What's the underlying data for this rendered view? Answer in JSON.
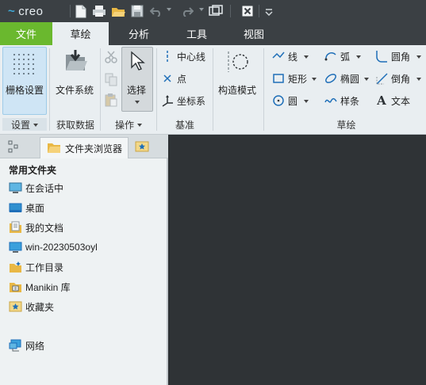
{
  "app": {
    "logo_text": "creo",
    "logo_mark": "~"
  },
  "quick_access": [
    "new-icon",
    "print-icon",
    "open-icon",
    "save-icon",
    "undo-icon",
    "redo-icon",
    "regenerate-icon",
    "close-window-icon",
    "customize-icon"
  ],
  "tabs": [
    {
      "label": "文件"
    },
    {
      "label": "草绘"
    },
    {
      "label": "分析"
    },
    {
      "label": "工具"
    },
    {
      "label": "视图"
    }
  ],
  "ribbon": {
    "setup": {
      "grid_label": "栅格设置",
      "group_label": "设置"
    },
    "get_data": {
      "file_system_label": "文件系统",
      "group_label": "获取数据"
    },
    "operations": {
      "select_label": "选择",
      "group_label": "操作"
    },
    "datum": {
      "centerline": "中心线",
      "point": "点",
      "coordinate_system": "坐标系",
      "group_label": "基准"
    },
    "construction": {
      "label": "构造模式"
    },
    "sketching": {
      "line": "线",
      "arc": "弧",
      "fillet": "圆角",
      "rectangle": "矩形",
      "ellipse": "椭圆",
      "chamfer": "倒角",
      "circle": "圆",
      "spline": "样条",
      "text": "文本",
      "group_label": "草绘"
    }
  },
  "navigator": {
    "tabs": [
      {
        "label": ""
      },
      {
        "label": "文件夹浏览器"
      },
      {
        "label": ""
      }
    ],
    "section_title": "常用文件夹",
    "items": [
      {
        "label": "在会话中"
      },
      {
        "label": "桌面"
      },
      {
        "label": "我的文档"
      },
      {
        "label": "win-20230503oyl"
      },
      {
        "label": "工作目录"
      },
      {
        "label": "Manikin 库"
      },
      {
        "label": "收藏夹"
      },
      {
        "label": "网络"
      }
    ]
  },
  "colors": {
    "file_tab": "#6ab82e",
    "ribbon_bg": "#e9eef1",
    "titlebar": "#3b4044",
    "graphics_area": "#2f3336",
    "accent_blue": "#1f6fb8"
  }
}
